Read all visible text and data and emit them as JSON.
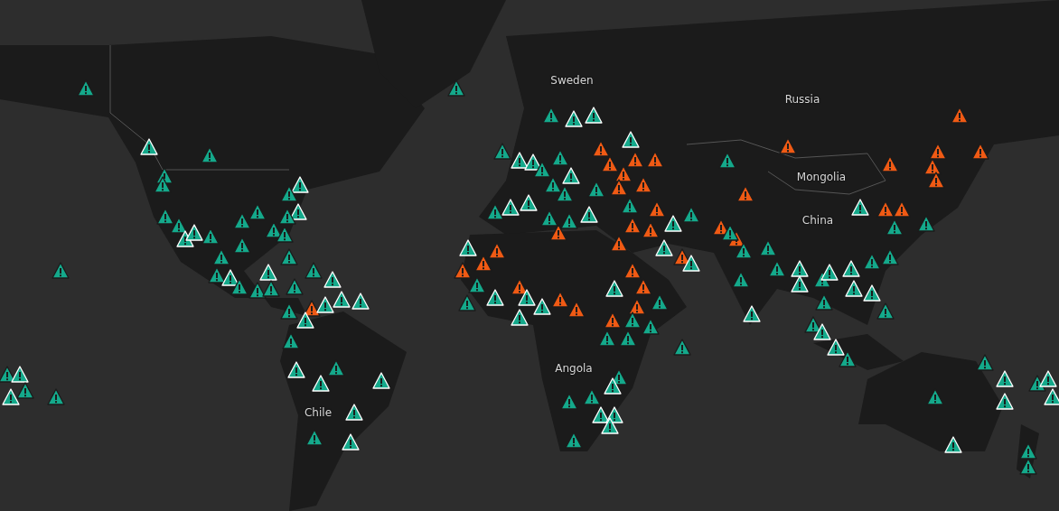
{
  "places": [
    {
      "name": "Sweden"
    },
    {
      "name": "Russia"
    },
    {
      "name": "Mongolia"
    },
    {
      "name": "China"
    },
    {
      "name": "Angola"
    },
    {
      "name": "Chile"
    }
  ],
  "markers": [
    {
      "color": "#14a98b",
      "outlined": false
    },
    {
      "color": "#14a98b",
      "outlined": false
    },
    {
      "color": "#14a98b",
      "outlined": true
    },
    {
      "color": "#14a98b",
      "outlined": false
    },
    {
      "color": "#14a98b",
      "outlined": false
    },
    {
      "color": "#14a98b",
      "outlined": false
    },
    {
      "color": "#14a98b",
      "outlined": true
    },
    {
      "color": "#14a98b",
      "outlined": false
    },
    {
      "color": "#14a98b",
      "outlined": true
    },
    {
      "color": "#14a98b",
      "outlined": false
    },
    {
      "color": "#14a98b",
      "outlined": false
    },
    {
      "color": "#14a98b",
      "outlined": false
    },
    {
      "color": "#14a98b",
      "outlined": false
    },
    {
      "color": "#14a98b",
      "outlined": false
    },
    {
      "color": "#14a98b",
      "outlined": false
    },
    {
      "color": "#14a98b",
      "outlined": false
    },
    {
      "color": "#14a98b",
      "outlined": true
    },
    {
      "color": "#14a98b",
      "outlined": true
    },
    {
      "color": "#14a98b",
      "outlined": false
    },
    {
      "color": "#14a98b",
      "outlined": false
    },
    {
      "color": "#14a98b",
      "outlined": false
    },
    {
      "color": "#14a98b",
      "outlined": false
    },
    {
      "color": "#14a98b",
      "outlined": false
    },
    {
      "color": "#14a98b",
      "outlined": false
    },
    {
      "color": "#14a98b",
      "outlined": true
    },
    {
      "color": "#14a98b",
      "outlined": false
    },
    {
      "color": "#14a98b",
      "outlined": true
    },
    {
      "color": "#14a98b",
      "outlined": false
    },
    {
      "color": "#14a98b",
      "outlined": false
    },
    {
      "color": "#14a98b",
      "outlined": false
    },
    {
      "color": "#14a98b",
      "outlined": false
    },
    {
      "color": "#14a98b",
      "outlined": true
    },
    {
      "color": "#14a98b",
      "outlined": true
    },
    {
      "color": "#14a98b",
      "outlined": true
    },
    {
      "color": "#14a98b",
      "outlined": false
    },
    {
      "color": "#f05a14",
      "outlined": false
    },
    {
      "color": "#14a98b",
      "outlined": true
    },
    {
      "color": "#14a98b",
      "outlined": true
    },
    {
      "color": "#14a98b",
      "outlined": false
    },
    {
      "color": "#14a98b",
      "outlined": true
    },
    {
      "color": "#14a98b",
      "outlined": false
    },
    {
      "color": "#14a98b",
      "outlined": true
    },
    {
      "color": "#14a98b",
      "outlined": true
    },
    {
      "color": "#14a98b",
      "outlined": true
    },
    {
      "color": "#14a98b",
      "outlined": false
    },
    {
      "color": "#14a98b",
      "outlined": true
    },
    {
      "color": "#14a98b",
      "outlined": false
    },
    {
      "color": "#14a98b",
      "outlined": true
    },
    {
      "color": "#14a98b",
      "outlined": false
    },
    {
      "color": "#14a98b",
      "outlined": true
    },
    {
      "color": "#14a98b",
      "outlined": false
    },
    {
      "color": "#14a98b",
      "outlined": false
    },
    {
      "color": "#14a98b",
      "outlined": true
    },
    {
      "color": "#14a98b",
      "outlined": true
    },
    {
      "color": "#14a98b",
      "outlined": false
    },
    {
      "color": "#14a98b",
      "outlined": true
    },
    {
      "color": "#14a98b",
      "outlined": true
    },
    {
      "color": "#14a98b",
      "outlined": false
    },
    {
      "color": "#14a98b",
      "outlined": false
    },
    {
      "color": "#14a98b",
      "outlined": true
    },
    {
      "color": "#14a98b",
      "outlined": false
    },
    {
      "color": "#14a98b",
      "outlined": false
    },
    {
      "color": "#14a98b",
      "outlined": false
    },
    {
      "color": "#f05a14",
      "outlined": false
    },
    {
      "color": "#f05a14",
      "outlined": false
    },
    {
      "color": "#14a98b",
      "outlined": true
    },
    {
      "color": "#f05a14",
      "outlined": false
    },
    {
      "color": "#f05a14",
      "outlined": false
    },
    {
      "color": "#f05a14",
      "outlined": false
    },
    {
      "color": "#f05a14",
      "outlined": false
    },
    {
      "color": "#f05a14",
      "outlined": false
    },
    {
      "color": "#f05a14",
      "outlined": false
    },
    {
      "color": "#f05a14",
      "outlined": false
    },
    {
      "color": "#f05a14",
      "outlined": false
    },
    {
      "color": "#14a98b",
      "outlined": true
    },
    {
      "color": "#14a98b",
      "outlined": false
    },
    {
      "color": "#14a98b",
      "outlined": true
    },
    {
      "color": "#f05a14",
      "outlined": false
    },
    {
      "color": "#14a98b",
      "outlined": true
    },
    {
      "color": "#14a98b",
      "outlined": false
    },
    {
      "color": "#f05a14",
      "outlined": false
    },
    {
      "color": "#f05a14",
      "outlined": false
    },
    {
      "color": "#14a98b",
      "outlined": false
    },
    {
      "color": "#14a98b",
      "outlined": true
    },
    {
      "color": "#14a98b",
      "outlined": true
    },
    {
      "color": "#14a98b",
      "outlined": false
    },
    {
      "color": "#14a98b",
      "outlined": false
    },
    {
      "color": "#14a98b",
      "outlined": true
    },
    {
      "color": "#14a98b",
      "outlined": true
    },
    {
      "color": "#f05a14",
      "outlined": false
    },
    {
      "color": "#f05a14",
      "outlined": false
    },
    {
      "color": "#f05a14",
      "outlined": false
    },
    {
      "color": "#14a98b",
      "outlined": false
    },
    {
      "color": "#14a98b",
      "outlined": false
    },
    {
      "color": "#14a98b",
      "outlined": true
    },
    {
      "color": "#f05a14",
      "outlined": false
    },
    {
      "color": "#14a98b",
      "outlined": true
    },
    {
      "color": "#14a98b",
      "outlined": true
    },
    {
      "color": "#14a98b",
      "outlined": true
    },
    {
      "color": "#f05a14",
      "outlined": false
    },
    {
      "color": "#f05a14",
      "outlined": false
    },
    {
      "color": "#14a98b",
      "outlined": true
    },
    {
      "color": "#f05a14",
      "outlined": false
    },
    {
      "color": "#f05a14",
      "outlined": false
    },
    {
      "color": "#f05a14",
      "outlined": false
    },
    {
      "color": "#f05a14",
      "outlined": false
    },
    {
      "color": "#14a98b",
      "outlined": false
    },
    {
      "color": "#14a98b",
      "outlined": false
    },
    {
      "color": "#14a98b",
      "outlined": false
    },
    {
      "color": "#14a98b",
      "outlined": false
    },
    {
      "color": "#14a98b",
      "outlined": false
    },
    {
      "color": "#14a98b",
      "outlined": false
    },
    {
      "color": "#14a98b",
      "outlined": false
    },
    {
      "color": "#14a98b",
      "outlined": true
    },
    {
      "color": "#14a98b",
      "outlined": false
    },
    {
      "color": "#14a98b",
      "outlined": false
    },
    {
      "color": "#14a98b",
      "outlined": true
    },
    {
      "color": "#14a98b",
      "outlined": true
    },
    {
      "color": "#14a98b",
      "outlined": true
    },
    {
      "color": "#14a98b",
      "outlined": false
    },
    {
      "color": "#14a98b",
      "outlined": false
    },
    {
      "color": "#f05a14",
      "outlined": false
    },
    {
      "color": "#f05a14",
      "outlined": false
    },
    {
      "color": "#f05a14",
      "outlined": false
    },
    {
      "color": "#f05a14",
      "outlined": false
    },
    {
      "color": "#f05a14",
      "outlined": false
    },
    {
      "color": "#14a98b",
      "outlined": false
    },
    {
      "color": "#14a98b",
      "outlined": false
    },
    {
      "color": "#14a98b",
      "outlined": false
    },
    {
      "color": "#14a98b",
      "outlined": false
    },
    {
      "color": "#14a98b",
      "outlined": false
    },
    {
      "color": "#14a98b",
      "outlined": true
    },
    {
      "color": "#14a98b",
      "outlined": true
    },
    {
      "color": "#14a98b",
      "outlined": false
    },
    {
      "color": "#14a98b",
      "outlined": true
    },
    {
      "color": "#14a98b",
      "outlined": true
    },
    {
      "color": "#14a98b",
      "outlined": false
    },
    {
      "color": "#14a98b",
      "outlined": false
    },
    {
      "color": "#14a98b",
      "outlined": true
    },
    {
      "color": "#14a98b",
      "outlined": true
    },
    {
      "color": "#14a98b",
      "outlined": false
    },
    {
      "color": "#14a98b",
      "outlined": false
    },
    {
      "color": "#14a98b",
      "outlined": true
    },
    {
      "color": "#14a98b",
      "outlined": false
    },
    {
      "color": "#14a98b",
      "outlined": true
    },
    {
      "color": "#14a98b",
      "outlined": false
    },
    {
      "color": "#14a98b",
      "outlined": true
    },
    {
      "color": "#f05a14",
      "outlined": false
    },
    {
      "color": "#f05a14",
      "outlined": false
    },
    {
      "color": "#14a98b",
      "outlined": false
    },
    {
      "color": "#14a98b",
      "outlined": false
    },
    {
      "color": "#f05a14",
      "outlined": false
    },
    {
      "color": "#f05a14",
      "outlined": false
    },
    {
      "color": "#f05a14",
      "outlined": false
    },
    {
      "color": "#f05a14",
      "outlined": false
    },
    {
      "color": "#f05a14",
      "outlined": false
    },
    {
      "color": "#14a98b",
      "outlined": true
    },
    {
      "color": "#14a98b",
      "outlined": false
    },
    {
      "color": "#14a98b",
      "outlined": true
    },
    {
      "color": "#14a98b",
      "outlined": false
    },
    {
      "color": "#14a98b",
      "outlined": true
    },
    {
      "color": "#14a98b",
      "outlined": true
    },
    {
      "color": "#14a98b",
      "outlined": true
    },
    {
      "color": "#14a98b",
      "outlined": false
    },
    {
      "color": "#14a98b",
      "outlined": true
    },
    {
      "color": "#14a98b",
      "outlined": false
    },
    {
      "color": "#14a98b",
      "outlined": false
    }
  ]
}
